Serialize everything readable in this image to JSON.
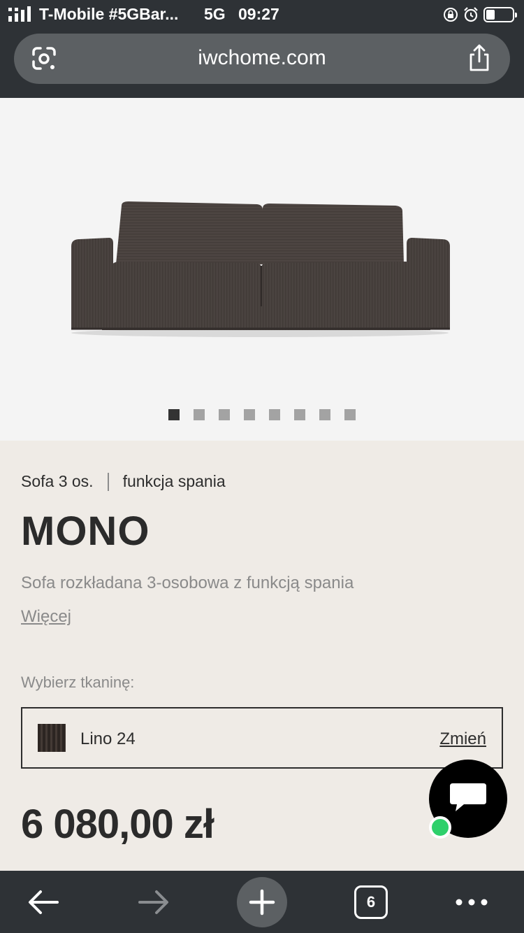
{
  "status_bar": {
    "carrier": "T-Mobile #5GBar...",
    "network": "5G",
    "time": "09:27"
  },
  "address_bar": {
    "url": "iwchome.com"
  },
  "gallery": {
    "total_images": 8,
    "active_index": 0
  },
  "product": {
    "category": "Sofa 3 os.",
    "feature": "funkcja spania",
    "name": "MONO",
    "description": "Sofa rozkładana 3-osobowa z funkcją spania",
    "more_link": "Więcej",
    "fabric_label": "Wybierz tkaninę:",
    "fabric_name": "Lino 24",
    "change_link": "Zmień",
    "price": "6 080,00 zł"
  },
  "toolbar": {
    "tab_count": "6"
  },
  "colors": {
    "browser_chrome": "#2e3236",
    "page_background": "#efebe6",
    "online_indicator": "#2ed06b"
  }
}
